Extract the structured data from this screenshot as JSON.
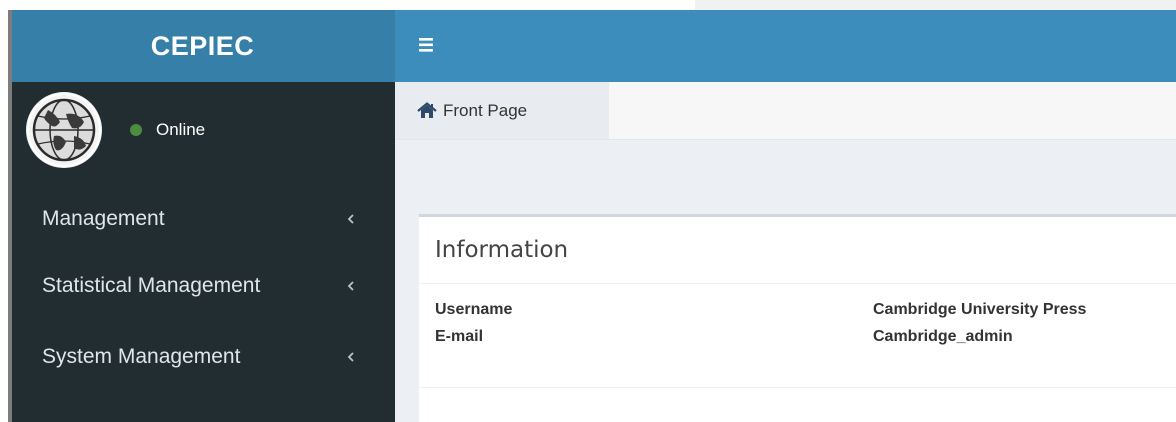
{
  "app": {
    "brand": "CEPIEC"
  },
  "user_panel": {
    "status_text": "Online",
    "status_color": "#4c8c40"
  },
  "sidebar": {
    "items": [
      {
        "label": "Management"
      },
      {
        "label": "Statistical Management"
      },
      {
        "label": "System Management"
      }
    ]
  },
  "tabs": {
    "front_page": "Front Page"
  },
  "info_panel": {
    "title": "Information",
    "rows": [
      {
        "label": "Username",
        "value": "Cambridge University Press"
      },
      {
        "label": "E-mail",
        "value": "Cambridge_admin"
      }
    ]
  },
  "colors": {
    "sidebar_bg": "#222d32",
    "logo_bar": "#367fa9",
    "navbar": "#3c8dbc",
    "content_bg": "#ecf0f5"
  },
  "icons": {
    "menu_toggle": "hamburger-icon",
    "front_page": "home-icon",
    "expand": "chevron-left-icon",
    "avatar": "globe-avatar"
  }
}
